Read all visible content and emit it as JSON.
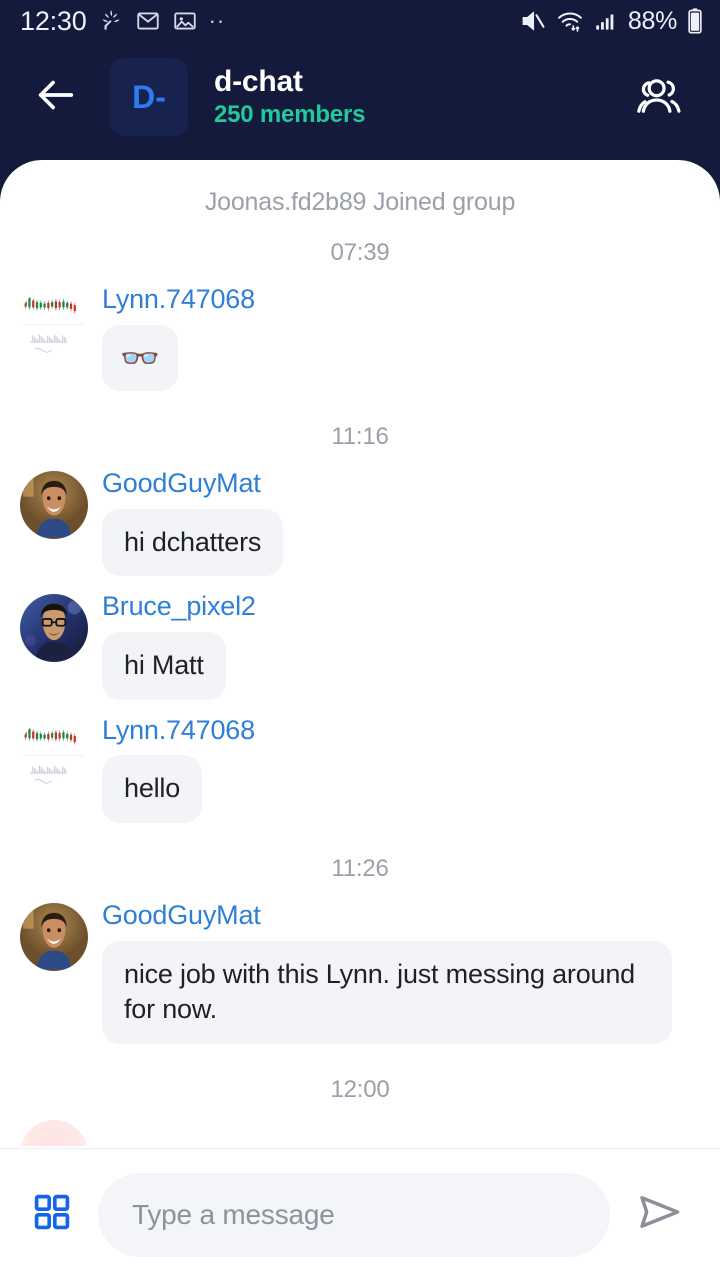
{
  "statusbar": {
    "time": "12:30",
    "tray_icons": [
      "flower-icon",
      "gmail-icon",
      "gallery-icon",
      "more-dots-icon"
    ],
    "dots": "··",
    "mute_icon": "volume-muted-icon",
    "wifi_icon": "wifi-icon",
    "signal_icon": "cellular-signal-icon",
    "battery_percent": "88%",
    "battery_icon": "battery-icon"
  },
  "header": {
    "back_icon": "back-arrow-icon",
    "badge_label": "D-",
    "title": "d-chat",
    "subtitle": "250 members",
    "members_icon": "group-people-icon",
    "bg_color": "#141a3c",
    "subtitle_color": "#22c99a",
    "badge_color": "#2f7bf0"
  },
  "colors": {
    "username": "#2f7fd8",
    "bubble_bg": "#f2f4f7",
    "meta_text": "#9b9fa8",
    "accent_blue": "#2f7bf0"
  },
  "conversation": [
    {
      "kind": "system",
      "text": "Joonas.fd2b89 Joined group"
    },
    {
      "kind": "time",
      "text": "07:39"
    },
    {
      "kind": "message",
      "author": "Lynn.747068",
      "avatar": "candlestick-chart-avatar",
      "text": "👓",
      "emoji_only": true
    },
    {
      "kind": "time",
      "text": "11:16"
    },
    {
      "kind": "message",
      "author": "GoodGuyMat",
      "avatar": "man-smiling-avatar",
      "text": "hi dchatters",
      "emoji_only": false
    },
    {
      "kind": "message",
      "author": "Bruce_pixel2",
      "avatar": "man-glasses-avatar",
      "text": "hi Matt",
      "emoji_only": false
    },
    {
      "kind": "message",
      "author": "Lynn.747068",
      "avatar": "candlestick-chart-avatar",
      "text": "hello",
      "emoji_only": false
    },
    {
      "kind": "time",
      "text": "11:26"
    },
    {
      "kind": "message",
      "author": "GoodGuyMat",
      "avatar": "man-smiling-avatar",
      "text": "nice job with this Lynn. just messing around for now.",
      "emoji_only": false
    },
    {
      "kind": "time",
      "text": "12:00"
    }
  ],
  "composer": {
    "grid_icon": "grid-apps-icon",
    "placeholder": "Type a message",
    "value": "",
    "send_icon": "send-paper-plane-icon"
  }
}
